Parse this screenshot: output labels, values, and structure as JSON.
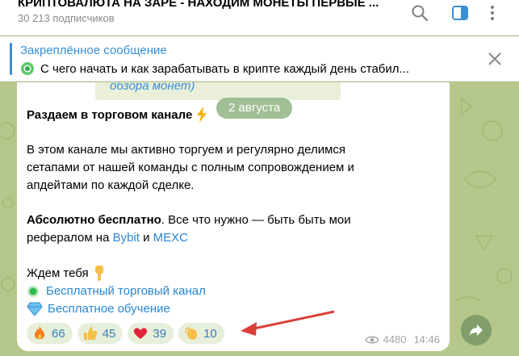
{
  "header": {
    "title": "КРИПТОВАЛЮТА НА ЗАРЕ - НАХОДИМ МОНЕТЫ ПЕРВЫЕ ...",
    "subscribers": "30 213 подписчиков",
    "icons": [
      "search-icon",
      "sidebar-toggle-icon",
      "more-icon"
    ]
  },
  "pinned": {
    "label": "Закреплённое сообщение",
    "text": "С чего начать и как зарабатывать в крипте каждый день стабил..."
  },
  "message": {
    "prev_text": "обзора монет)",
    "heading": "Раздаем в торговом канале",
    "date": "2 августа",
    "para1": [
      "В этом канале мы активно торгуем и регулярно делимся",
      "сетапами от нашей команды с полным сопровождением и",
      "апдейтами по каждой сделке."
    ],
    "para2_bold": "Абсолютно бесплатно",
    "para2_rest": ". Все что нужно — быть быть мои",
    "para2_line2_pre": "рефералом на ",
    "link_bybit": "Bybit",
    "and": " и ",
    "link_mexc": "MEXC",
    "wait": "Ждем тебя",
    "link_channel": "Бесплатный торговый канал",
    "link_training": "Бесплатное обучение",
    "views": "4480",
    "time": "14:46"
  },
  "reactions": [
    {
      "icon": "fire-icon",
      "count": "66"
    },
    {
      "icon": "thumbs-up-icon",
      "count": "45"
    },
    {
      "icon": "heart-icon",
      "count": "39"
    },
    {
      "icon": "clap-icon",
      "count": "10"
    }
  ],
  "colors": {
    "accent": "#3a8fd6",
    "reaction_bg": "#e6efda",
    "wallpaper": "#b5c78a",
    "arrow": "#d9403a"
  }
}
